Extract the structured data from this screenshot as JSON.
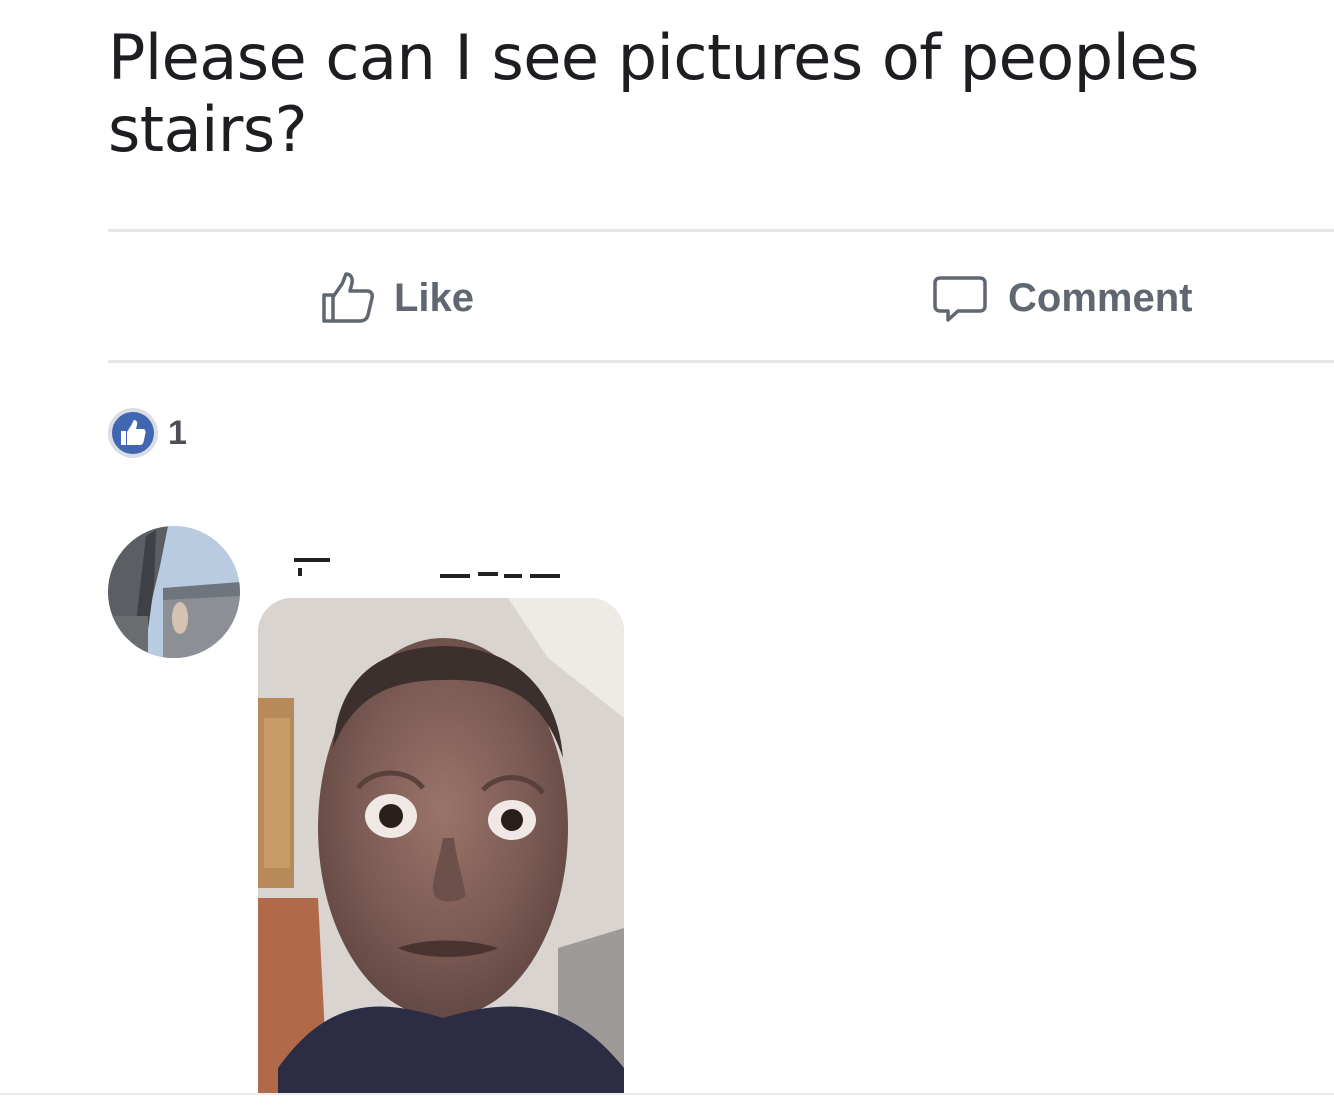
{
  "post": {
    "text": "Please can I see pictures of peoples stairs?"
  },
  "actions": {
    "like_label": "Like",
    "comment_label": "Comment"
  },
  "reactions": {
    "count": "1",
    "icon": "thumbs-up-icon",
    "badge_color": "#4267b2"
  },
  "comment": {
    "avatar": "avatar",
    "photo": "selfie-photo"
  }
}
